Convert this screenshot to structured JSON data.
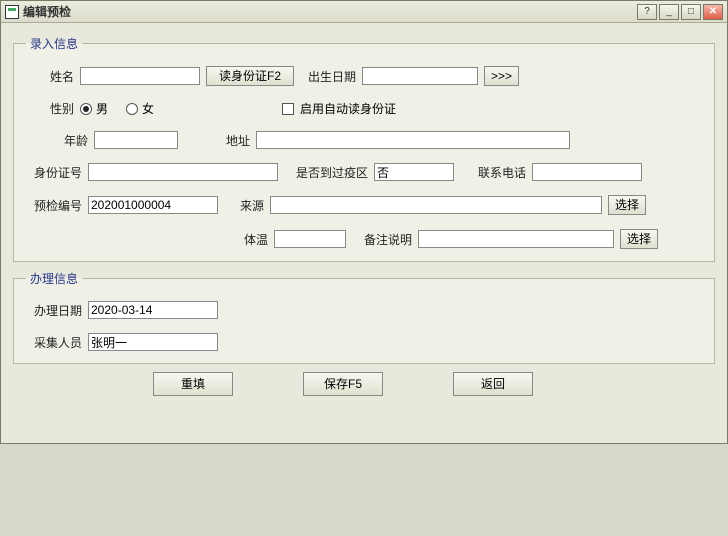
{
  "window": {
    "title": "编辑预检"
  },
  "entry": {
    "legend": "录入信息",
    "name_label": "姓名",
    "name_value": "",
    "read_id_btn": "读身份证F2",
    "dob_label": "出生日期",
    "dob_value": "",
    "dob_btn": ">>>",
    "gender_label": "性别",
    "gender_male": "男",
    "gender_female": "女",
    "gender_selected": "男",
    "auto_read_label": "启用自动读身份证",
    "auto_read_checked": false,
    "age_label": "年龄",
    "age_value": "",
    "address_label": "地址",
    "address_value": "",
    "idno_label": "身份证号",
    "idno_value": "",
    "epidemic_label": "是否到过疫区",
    "epidemic_value": "否",
    "phone_label": "联系电话",
    "phone_value": "",
    "precheck_no_label": "预检编号",
    "precheck_no_value": "202001000004",
    "source_label": "来源",
    "source_value": "",
    "select_btn": "选择",
    "temp_label": "体温",
    "temp_value": "",
    "remark_label": "备注说明",
    "remark_value": "",
    "select_btn2": "选择"
  },
  "process": {
    "legend": "办理信息",
    "date_label": "办理日期",
    "date_value": "2020-03-14",
    "staff_label": "采集人员",
    "staff_value": "张明一"
  },
  "actions": {
    "reset": "重填",
    "save": "保存F5",
    "back": "返回"
  }
}
